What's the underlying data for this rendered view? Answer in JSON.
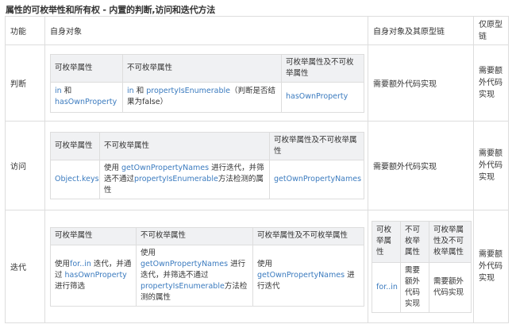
{
  "title": "属性的可枚举性和所有权 - 内置的判断,访问和迭代方法",
  "header": {
    "feature": "功能",
    "own": "自身对象",
    "own_proto": "自身对象及其原型链",
    "proto_only": "仅原型链"
  },
  "rows": {
    "judge": {
      "label": "判断",
      "inner": {
        "h1": "可枚举属性",
        "h2": "不可枚举属性",
        "h3": "可枚举属性及不可枚举属性",
        "c1_a": "in",
        "c1_b": " 和 ",
        "c1_c": "hasOwnProperty",
        "c2_a": "in",
        "c2_b": " 和 ",
        "c2_c": "propertyIsEnumerable",
        "c2_d": "（判断是否结果为false）",
        "c3": "hasOwnProperty"
      },
      "own_proto": "需要额外代码实现",
      "proto_only": "需要额外代码实现"
    },
    "access": {
      "label": "访问",
      "inner": {
        "h1": "可枚举属性",
        "h2": "不可枚举属性",
        "h3": "可枚举属性及不可枚举属性",
        "c1": "Object.keys",
        "c2_a": "使用 ",
        "c2_b": "getOwnPropertyNames",
        "c2_c": " 进行迭代，并筛选不通过",
        "c2_d": "propertyIsEnumerable",
        "c2_e": "方法检测的属性",
        "c3": "getOwnPropertyNames"
      },
      "own_proto": "需要额外代码实现",
      "proto_only": "需要额外代码实现"
    },
    "iterate": {
      "label": "迭代",
      "inner": {
        "h1": "可枚举属性",
        "h2": "不可枚举属性",
        "h3": "可枚举属性及不可枚举属性",
        "c1_a": "使用",
        "c1_b": "for..in",
        "c1_c": " 迭代，并通过 ",
        "c1_d": "hasOwnProperty",
        "c1_e": "进行筛选",
        "c2_a": "使用 ",
        "c2_b": "getOwnPropertyNames",
        "c2_c": " 进行迭代，并筛选不通过",
        "c2_d": "propertyIsEnumerable",
        "c2_e": "方法检测的属性",
        "c3_a": "使用 ",
        "c3_b": "getOwnPropertyNames",
        "c3_c": " 进行迭代"
      },
      "proto_inner": {
        "h1": "可枚举属性",
        "h2": "不可枚举属性",
        "h3": "可枚举属性及不可枚举属性",
        "c1": "for..in",
        "c2": "需要额外代码实现",
        "c3": "需要额外代码实现"
      },
      "proto_only": "需要额外代码实现"
    }
  }
}
